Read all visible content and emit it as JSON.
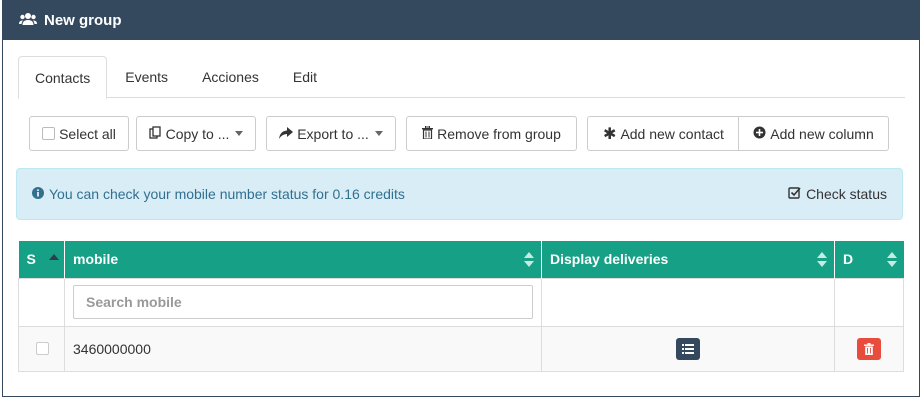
{
  "panel": {
    "title": "New group"
  },
  "tabs": [
    {
      "label": "Contacts",
      "active": true
    },
    {
      "label": "Events",
      "active": false
    },
    {
      "label": "Acciones",
      "active": false
    },
    {
      "label": "Edit",
      "active": false
    }
  ],
  "toolbar": {
    "select_all": "Select all",
    "copy_to": "Copy to ...",
    "export_to": "Export to ...",
    "remove_from_group": "Remove from group",
    "add_new_contact": "Add new contact",
    "add_new_column": "Add new column"
  },
  "alert": {
    "message": "You can check your mobile number status for 0.16 credits",
    "action": "Check status"
  },
  "table": {
    "columns": [
      "S",
      "mobile",
      "Display deliveries",
      "D"
    ],
    "search_placeholder": "Search mobile",
    "rows": [
      {
        "mobile": "3460000000"
      }
    ]
  },
  "colors": {
    "header_bg": "#34495e",
    "table_header_bg": "#16a085",
    "alert_bg": "#d9edf7",
    "delete_red": "#e74c3c"
  }
}
